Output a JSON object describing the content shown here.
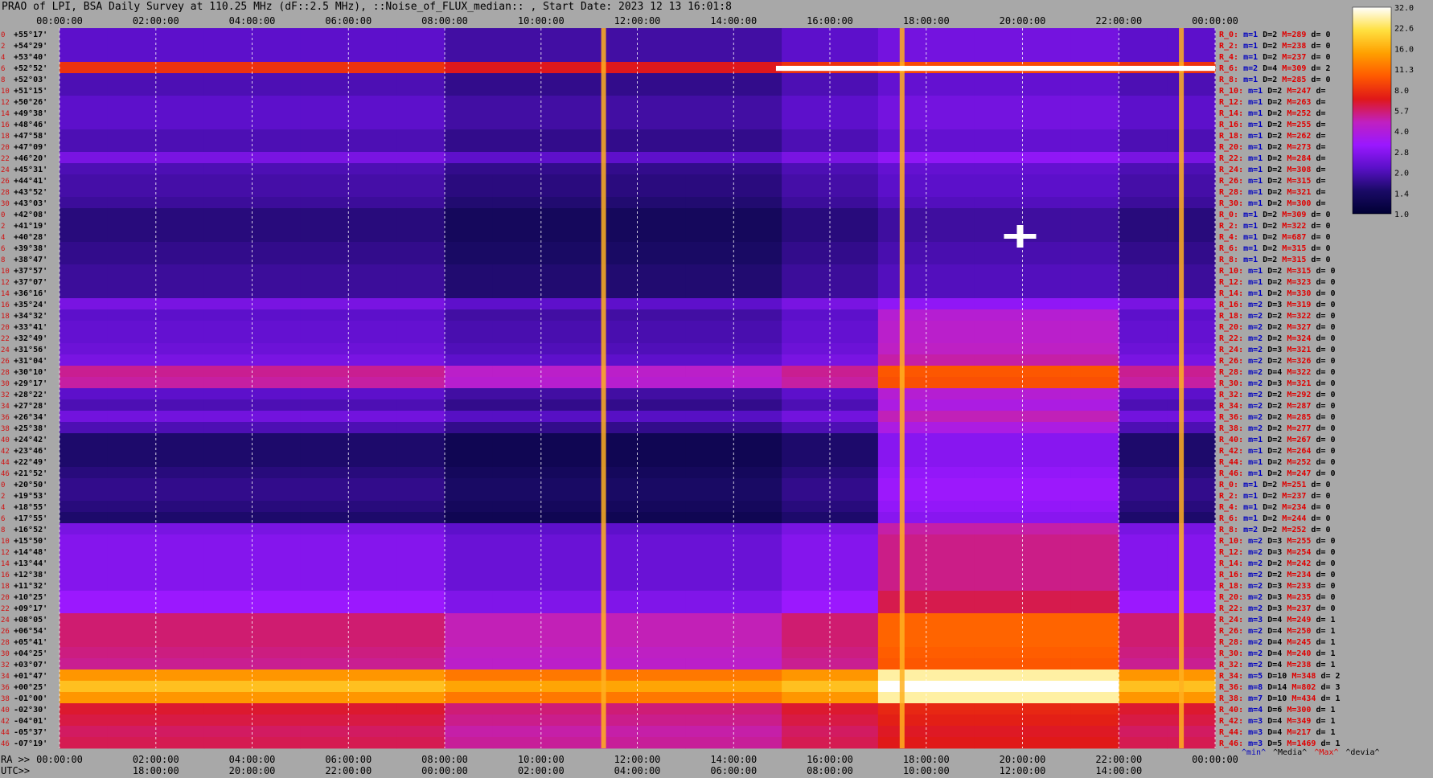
{
  "title": "PRAO of LPI, BSA Daily Survey at 110.25 MHz (dF::2.5 MHz), ::Noise_of_FLUX_median:: , Start Date: 2023 12 13 16:01:8",
  "chart_data": {
    "type": "heatmap",
    "top_axis_labels": [
      "00:00:00",
      "02:00:00",
      "04:00:00",
      "06:00:00",
      "08:00:00",
      "10:00:00",
      "12:00:00",
      "14:00:00",
      "16:00:00",
      "18:00:00",
      "20:00:00",
      "22:00:00",
      "00:00:00"
    ],
    "bottom_ra_prefix": "RA >>",
    "bottom_ra_labels": [
      "00:00:00",
      "02:00:00",
      "04:00:00",
      "06:00:00",
      "08:00:00",
      "10:00:00",
      "12:00:00",
      "14:00:00",
      "16:00:00",
      "18:00:00",
      "20:00:00",
      "22:00:00",
      "00:00:00"
    ],
    "bottom_utc_prefix": "UTC>>",
    "bottom_utc_labels": [
      "18:00:00",
      "20:00:00",
      "22:00:00",
      "00:00:00",
      "02:00:00",
      "04:00:00",
      "06:00:00",
      "08:00:00",
      "10:00:00",
      "12:00:00",
      "14:00:00"
    ],
    "declinations": [
      "+55°17'",
      "+54°29'",
      "+53°40'",
      "+52°52'",
      "+52°03'",
      "+51°15'",
      "+50°26'",
      "+49°38'",
      "+48°46'",
      "+47°58'",
      "+47°09'",
      "+46°20'",
      "+45°31'",
      "+44°41'",
      "+43°52'",
      "+43°03'",
      "+42°08'",
      "+41°19'",
      "+40°28'",
      "+39°38'",
      "+38°47'",
      "+37°57'",
      "+37°07'",
      "+36°16'",
      "+35°24'",
      "+34°32'",
      "+33°41'",
      "+32°49'",
      "+31°56'",
      "+31°04'",
      "+30°10'",
      "+29°17'",
      "+28°22'",
      "+27°28'",
      "+26°34'",
      "+25°38'",
      "+24°42'",
      "+23°46'",
      "+22°49'",
      "+21°52'",
      "+20°50'",
      "+19°53'",
      "+18°55'",
      "+17°55'",
      "+16°52'",
      "+15°50'",
      "+14°48'",
      "+13°44'",
      "+12°38'",
      "+11°32'",
      "+10°25'",
      "+09°17'",
      "+08°05'",
      "+06°54'",
      "+05°41'",
      "+04°25'",
      "+03°07'",
      "+01°47'",
      "+00°25'",
      "-01°00'",
      "-02°30'",
      "-04°01'",
      "-05°37'",
      "-07°19'"
    ],
    "row_numbers": [
      "0",
      "2",
      "4",
      "6",
      "8",
      "10",
      "12",
      "14",
      "16",
      "18",
      "20",
      "22",
      "24",
      "26",
      "28",
      "30",
      "0",
      "2",
      "4",
      "6",
      "8",
      "10",
      "12",
      "14",
      "16",
      "18",
      "20",
      "22",
      "24",
      "26",
      "28",
      "30",
      "32",
      "34",
      "36",
      "38",
      "40",
      "42",
      "44",
      "46",
      "0",
      "2",
      "4",
      "6",
      "8",
      "10",
      "12",
      "14",
      "16",
      "18",
      "20",
      "22",
      "24",
      "26",
      "28",
      "30",
      "32",
      "34",
      "36",
      "38",
      "40",
      "42",
      "44",
      "46"
    ],
    "stats": [
      {
        "r": "R_0:",
        "m": "m=1",
        "d": "D=2",
        "M": "M=289",
        "dv": "d= 0"
      },
      {
        "r": "R_2:",
        "m": "m=1",
        "d": "D=2",
        "M": "M=238",
        "dv": "d= 0"
      },
      {
        "r": "R_4:",
        "m": "m=1",
        "d": "D=2",
        "M": "M=237",
        "dv": "d= 0"
      },
      {
        "r": "R_6:",
        "m": "m=2",
        "d": "D=4",
        "M": "M=309",
        "dv": "d= 2"
      },
      {
        "r": "R_8:",
        "m": "m=1",
        "d": "D=2",
        "M": "M=285",
        "dv": "d= 0"
      },
      {
        "r": "R_10:",
        "m": "m=1",
        "d": "D=2",
        "M": "M=247",
        "dv": "d="
      },
      {
        "r": "R_12:",
        "m": "m=1",
        "d": "D=2",
        "M": "M=263",
        "dv": "d="
      },
      {
        "r": "R_14:",
        "m": "m=1",
        "d": "D=2",
        "M": "M=252",
        "dv": "d="
      },
      {
        "r": "R_16:",
        "m": "m=1",
        "d": "D=2",
        "M": "M=255",
        "dv": "d="
      },
      {
        "r": "R_18:",
        "m": "m=1",
        "d": "D=2",
        "M": "M=262",
        "dv": "d="
      },
      {
        "r": "R_20:",
        "m": "m=1",
        "d": "D=2",
        "M": "M=273",
        "dv": "d="
      },
      {
        "r": "R_22:",
        "m": "m=1",
        "d": "D=2",
        "M": "M=284",
        "dv": "d="
      },
      {
        "r": "R_24:",
        "m": "m=1",
        "d": "D=2",
        "M": "M=308",
        "dv": "d="
      },
      {
        "r": "R_26:",
        "m": "m=1",
        "d": "D=2",
        "M": "M=315",
        "dv": "d="
      },
      {
        "r": "R_28:",
        "m": "m=1",
        "d": "D=2",
        "M": "M=321",
        "dv": "d="
      },
      {
        "r": "R_30:",
        "m": "m=1",
        "d": "D=2",
        "M": "M=300",
        "dv": "d="
      },
      {
        "r": "R_0:",
        "m": "m=1",
        "d": "D=2",
        "M": "M=309",
        "dv": "d= 0"
      },
      {
        "r": "R_2:",
        "m": "m=1",
        "d": "D=2",
        "M": "M=322",
        "dv": "d= 0"
      },
      {
        "r": "R_4:",
        "m": "m=1",
        "d": "D=2",
        "M": "M=687",
        "dv": "d= 0"
      },
      {
        "r": "R_6:",
        "m": "m=1",
        "d": "D=2",
        "M": "M=315",
        "dv": "d= 0"
      },
      {
        "r": "R_8:",
        "m": "m=1",
        "d": "D=2",
        "M": "M=315",
        "dv": "d= 0"
      },
      {
        "r": "R_10:",
        "m": "m=1",
        "d": "D=2",
        "M": "M=315",
        "dv": "d= 0"
      },
      {
        "r": "R_12:",
        "m": "m=1",
        "d": "D=2",
        "M": "M=323",
        "dv": "d= 0"
      },
      {
        "r": "R_14:",
        "m": "m=1",
        "d": "D=2",
        "M": "M=330",
        "dv": "d= 0"
      },
      {
        "r": "R_16:",
        "m": "m=2",
        "d": "D=3",
        "M": "M=319",
        "dv": "d= 0"
      },
      {
        "r": "R_18:",
        "m": "m=2",
        "d": "D=2",
        "M": "M=322",
        "dv": "d= 0"
      },
      {
        "r": "R_20:",
        "m": "m=2",
        "d": "D=2",
        "M": "M=327",
        "dv": "d= 0"
      },
      {
        "r": "R_22:",
        "m": "m=2",
        "d": "D=2",
        "M": "M=324",
        "dv": "d= 0"
      },
      {
        "r": "R_24:",
        "m": "m=2",
        "d": "D=3",
        "M": "M=321",
        "dv": "d= 0"
      },
      {
        "r": "R_26:",
        "m": "m=2",
        "d": "D=2",
        "M": "M=326",
        "dv": "d= 0"
      },
      {
        "r": "R_28:",
        "m": "m=2",
        "d": "D=4",
        "M": "M=322",
        "dv": "d= 0"
      },
      {
        "r": "R_30:",
        "m": "m=2",
        "d": "D=3",
        "M": "M=321",
        "dv": "d= 0"
      },
      {
        "r": "R_32:",
        "m": "m=2",
        "d": "D=2",
        "M": "M=292",
        "dv": "d= 0"
      },
      {
        "r": "R_34:",
        "m": "m=2",
        "d": "D=2",
        "M": "M=287",
        "dv": "d= 0"
      },
      {
        "r": "R_36:",
        "m": "m=2",
        "d": "D=2",
        "M": "M=285",
        "dv": "d= 0"
      },
      {
        "r": "R_38:",
        "m": "m=2",
        "d": "D=2",
        "M": "M=277",
        "dv": "d= 0"
      },
      {
        "r": "R_40:",
        "m": "m=1",
        "d": "D=2",
        "M": "M=267",
        "dv": "d= 0"
      },
      {
        "r": "R_42:",
        "m": "m=1",
        "d": "D=2",
        "M": "M=264",
        "dv": "d= 0"
      },
      {
        "r": "R_44:",
        "m": "m=1",
        "d": "D=2",
        "M": "M=252",
        "dv": "d= 0"
      },
      {
        "r": "R_46:",
        "m": "m=1",
        "d": "D=2",
        "M": "M=247",
        "dv": "d= 0"
      },
      {
        "r": "R_0:",
        "m": "m=1",
        "d": "D=2",
        "M": "M=251",
        "dv": "d= 0"
      },
      {
        "r": "R_2:",
        "m": "m=1",
        "d": "D=2",
        "M": "M=237",
        "dv": "d= 0"
      },
      {
        "r": "R_4:",
        "m": "m=1",
        "d": "D=2",
        "M": "M=234",
        "dv": "d= 0"
      },
      {
        "r": "R_6:",
        "m": "m=1",
        "d": "D=2",
        "M": "M=244",
        "dv": "d= 0"
      },
      {
        "r": "R_8:",
        "m": "m=2",
        "d": "D=2",
        "M": "M=252",
        "dv": "d= 0"
      },
      {
        "r": "R_10:",
        "m": "m=2",
        "d": "D=3",
        "M": "M=255",
        "dv": "d= 0"
      },
      {
        "r": "R_12:",
        "m": "m=2",
        "d": "D=3",
        "M": "M=254",
        "dv": "d= 0"
      },
      {
        "r": "R_14:",
        "m": "m=2",
        "d": "D=2",
        "M": "M=242",
        "dv": "d= 0"
      },
      {
        "r": "R_16:",
        "m": "m=2",
        "d": "D=2",
        "M": "M=234",
        "dv": "d= 0"
      },
      {
        "r": "R_18:",
        "m": "m=2",
        "d": "D=3",
        "M": "M=233",
        "dv": "d= 0"
      },
      {
        "r": "R_20:",
        "m": "m=2",
        "d": "D=3",
        "M": "M=235",
        "dv": "d= 0"
      },
      {
        "r": "R_22:",
        "m": "m=2",
        "d": "D=3",
        "M": "M=237",
        "dv": "d= 0"
      },
      {
        "r": "R_24:",
        "m": "m=3",
        "d": "D=4",
        "M": "M=249",
        "dv": "d= 1"
      },
      {
        "r": "R_26:",
        "m": "m=2",
        "d": "D=4",
        "M": "M=250",
        "dv": "d= 1"
      },
      {
        "r": "R_28:",
        "m": "m=2",
        "d": "D=4",
        "M": "M=245",
        "dv": "d= 1"
      },
      {
        "r": "R_30:",
        "m": "m=2",
        "d": "D=4",
        "M": "M=240",
        "dv": "d= 1"
      },
      {
        "r": "R_32:",
        "m": "m=2",
        "d": "D=4",
        "M": "M=238",
        "dv": "d= 1"
      },
      {
        "r": "R_34:",
        "m": "m=5",
        "d": "D=10",
        "M": "M=348",
        "dv": "d= 2"
      },
      {
        "r": "R_36:",
        "m": "m=8",
        "d": "D=14",
        "M": "M=802",
        "dv": "d= 3"
      },
      {
        "r": "R_38:",
        "m": "m=7",
        "d": "D=10",
        "M": "M=434",
        "dv": "d= 1"
      },
      {
        "r": "R_40:",
        "m": "m=4",
        "d": "D=6",
        "M": "M=300",
        "dv": "d= 1"
      },
      {
        "r": "R_42:",
        "m": "m=3",
        "d": "D=4",
        "M": "M=349",
        "dv": "d= 1"
      },
      {
        "r": "R_44:",
        "m": "m=3",
        "d": "D=4",
        "M": "M=217",
        "dv": "d= 1"
      },
      {
        "r": "R_46:",
        "m": "m=3",
        "d": "D=5",
        "M": "M=1469",
        "dv": "d= 1"
      }
    ],
    "stats_legend": [
      "^min^",
      "^Media^",
      "^Max^",
      "^devia^"
    ],
    "colorbar_ticks": [
      "32.0",
      "22.6",
      "16.0",
      "11.3",
      "8.0",
      "5.7",
      "4.0",
      "2.8",
      "2.0",
      "1.4",
      "1.0"
    ],
    "colorbar_range": [
      1.0,
      32.0
    ],
    "colorbar_scale": "log",
    "colormap_stops": [
      "#000033",
      "#1a0a66",
      "#5a10c8",
      "#9a18ff",
      "#c020c0",
      "#e01818",
      "#ff5a00",
      "#ffa000",
      "#ffe040",
      "#ffffff"
    ],
    "band_levels": [
      2.2,
      2.2,
      2.2,
      8,
      2.0,
      2.0,
      2.2,
      2.2,
      2.2,
      2.0,
      2.0,
      2.6,
      2.0,
      1.9,
      1.9,
      1.8,
      1.6,
      1.6,
      1.6,
      1.7,
      1.7,
      1.8,
      1.8,
      1.8,
      2.6,
      2.2,
      2.3,
      2.3,
      2.4,
      2.6,
      5.2,
      5.0,
      2.2,
      2.0,
      2.5,
      2.0,
      1.5,
      1.5,
      1.5,
      1.6,
      1.7,
      1.7,
      1.6,
      1.5,
      2.6,
      2.8,
      2.8,
      2.8,
      2.8,
      2.8,
      3.2,
      3.2,
      5.6,
      5.6,
      5.6,
      5.4,
      5.2,
      14,
      18,
      14,
      6.5,
      6.2,
      5.8,
      6.0
    ],
    "vertical_features_hours": [
      11.3,
      17.5,
      23.3
    ],
    "point_sources": [
      {
        "hour": 19.95,
        "dec": "+40°28'"
      }
    ]
  }
}
